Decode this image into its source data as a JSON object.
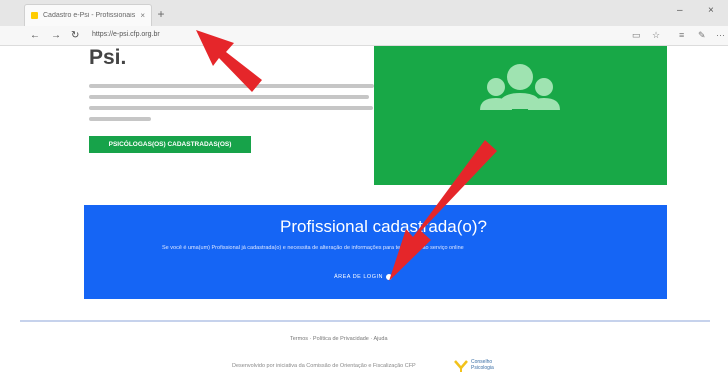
{
  "browser": {
    "tab_title": "Cadastro e-Psi - Profissionais",
    "tab_close": "×",
    "new_tab": "+",
    "url": "https://e-psi.cfp.org.br",
    "window_minimize": "–",
    "window_close": "×"
  },
  "page": {
    "title": "Psi.",
    "green_button": "PSICÓLOGAS(OS) CADASTRADAS(OS)",
    "blue_heading": "Profissional cadastrada(o)?",
    "blue_subtext": "Se você é uma(um) Profissional já cadastrada(o) e necessita de alteração de informações para ter acesso ao serviço online",
    "blue_link": "ÁREA DE LOGIN",
    "footer_links": "Termos · Política de Privacidade · Ajuda",
    "footer_credit": "Desenvolvido por iniciativa da Comissão de Orientação e Fiscalização CFP",
    "footer_logo_line1": "Conselho",
    "footer_logo_line2": "Psicologia"
  },
  "colors": {
    "green": "#18a847",
    "blue": "#1565f5",
    "arrow": "#e5262a"
  },
  "icons": [
    "back-icon",
    "forward-icon",
    "refresh-icon",
    "users-icon",
    "info-icon",
    "star-icon",
    "menu-icon"
  ]
}
